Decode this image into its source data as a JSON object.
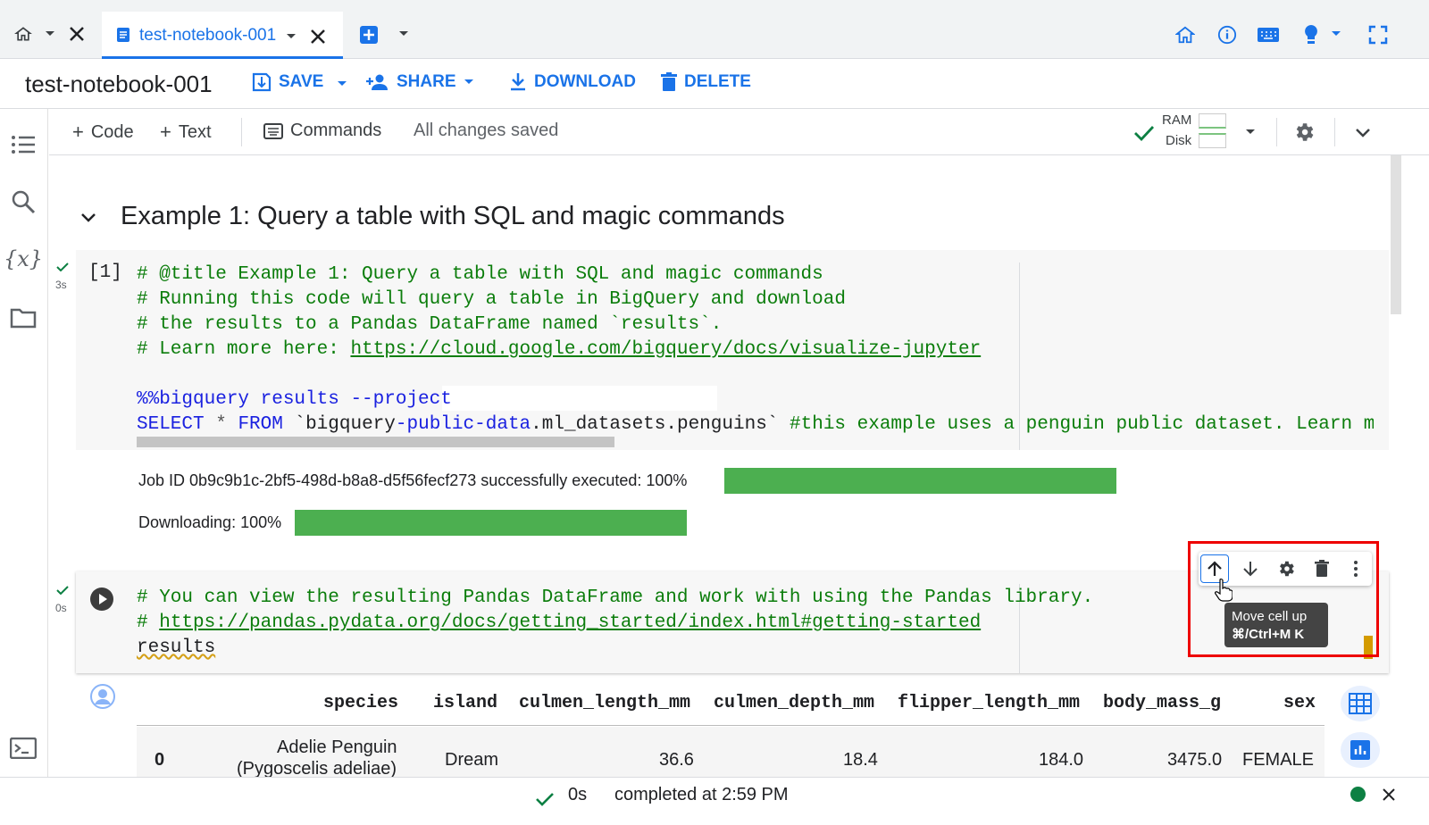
{
  "tabbar": {
    "tab_title": "test-notebook-001"
  },
  "header": {
    "notebook_title": "test-notebook-001",
    "save": "SAVE",
    "share": "SHARE",
    "download": "DOWNLOAD",
    "delete": "DELETE"
  },
  "toolbar": {
    "code": "Code",
    "text": "Text",
    "commands": "Commands",
    "status": "All changes saved",
    "ram": "RAM",
    "disk": "Disk"
  },
  "section": {
    "heading": "Example 1: Query a table with SQL and magic commands"
  },
  "cell1": {
    "exec_count": "[1]",
    "exec_time": "3s",
    "line1": "# @title Example 1: Query a table with SQL and magic commands",
    "line2": "# Running this code will query a table in BigQuery and download",
    "line3": "# the results to a Pandas DataFrame named `results`.",
    "line4_prefix": "# Learn more here: ",
    "line4_link": "https://cloud.google.com/bigquery/docs/visualize-jupyter",
    "line6_magic": "%%bigquery results --project",
    "line7_select": "SELECT",
    "line7_star": " * ",
    "line7_from": "FROM",
    "line7_table1": " `bigquery",
    "line7_dash1": "-",
    "line7_public": "public",
    "line7_dash2": "-",
    "line7_data": "data",
    "line7_rest": ".ml_datasets.penguins` ",
    "line7_comment": "#this example uses a penguin public dataset. Learn mor",
    "job_text": "Job ID 0b9c9b1c-2bf5-498d-b8a8-d5f56fecf273 successfully executed: 100%",
    "download_text": "Downloading: 100%",
    "job_progress": 1.0,
    "download_progress": 1.0
  },
  "cell2": {
    "exec_time": "0s",
    "line1": "# You can view the resulting Pandas DataFrame and work with using the Pandas library.",
    "line2_prefix": "# ",
    "line2_link": "https://pandas.pydata.org/docs/getting_started/index.html#getting-started",
    "line3": "results"
  },
  "cell_toolbar": {
    "tooltip_title": "Move cell up",
    "tooltip_shortcut": "⌘/Ctrl+M K"
  },
  "table": {
    "columns": [
      "species",
      "island",
      "culmen_length_mm",
      "culmen_depth_mm",
      "flipper_length_mm",
      "body_mass_g",
      "sex"
    ],
    "rows": [
      {
        "index": "0",
        "species_line1": "Adelie Penguin",
        "species_line2": "(Pygoscelis adeliae)",
        "island": "Dream",
        "culmen_length_mm": "36.6",
        "culmen_depth_mm": "18.4",
        "flipper_length_mm": "184.0",
        "body_mass_g": "3475.0",
        "sex": "FEMALE"
      }
    ]
  },
  "status": {
    "time": "0s",
    "completed": "completed at 2:59 PM"
  },
  "colors": {
    "accent": "#1a73e8",
    "progress": "#4caf50",
    "check": "#0d8043",
    "highlight": "#e00000"
  }
}
